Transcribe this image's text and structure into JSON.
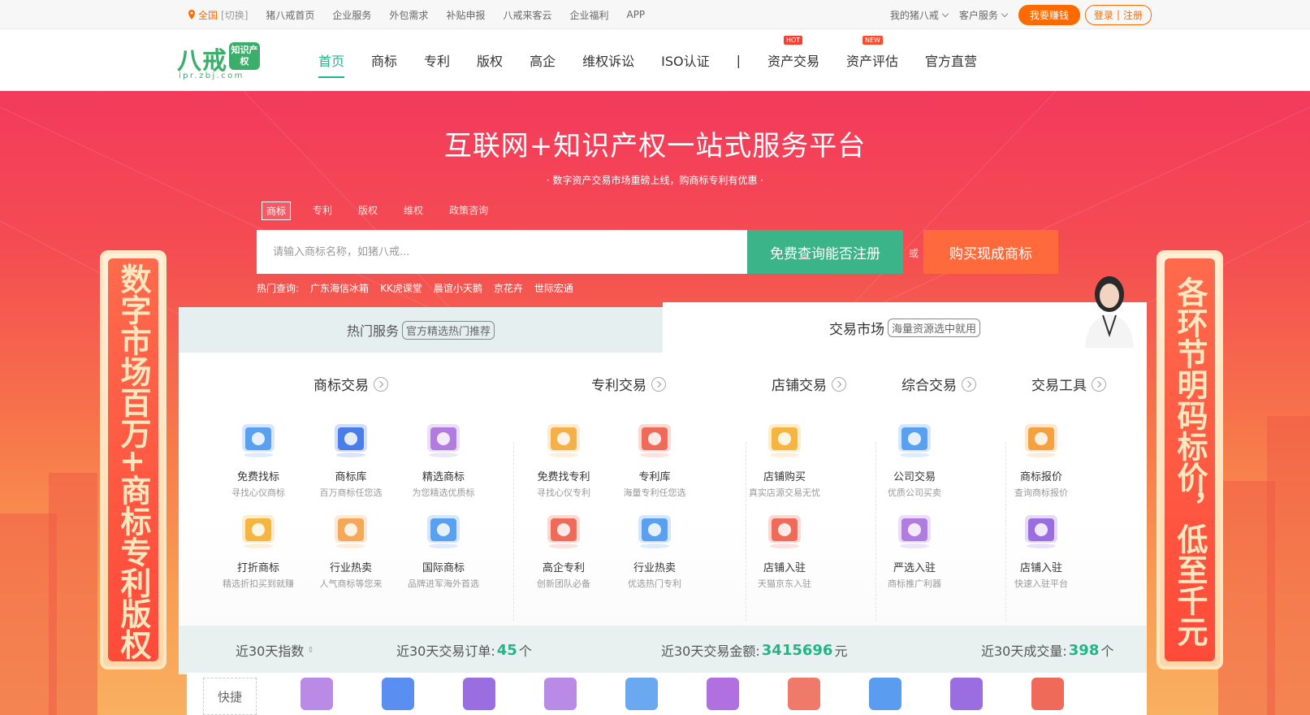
{
  "topbar": {
    "location_all": "全国",
    "location_switch": "[切换]",
    "links": [
      "猪八戒首页",
      "企业服务",
      "外包需求",
      "补贴申报",
      "八戒来客云",
      "企业福利",
      "APP"
    ],
    "my_zbj": "我的猪八戒",
    "customer_service": "客户服务",
    "earn_button": "我要赚钱",
    "login": "登录",
    "register": "注册"
  },
  "logo": {
    "mark": "八戒",
    "badge": "知识产权",
    "url": "ipr.zbj.com"
  },
  "nav": {
    "items": [
      "首页",
      "商标",
      "专利",
      "版权",
      "高企",
      "维权诉讼",
      "ISO认证",
      "|",
      "资产交易",
      "资产评估",
      "官方直营"
    ],
    "hot_tag": "HOT",
    "new_tag": "NEW"
  },
  "banner": {
    "headline": "互联网+知识产权一站式服务平台",
    "subline": "· 数字资产交易市场重磅上线，购商标专利有优惠 ·",
    "left_vertical": "数字市场百万+商标专利版权",
    "right_vertical": "各环节明码标价，低至千元起"
  },
  "search": {
    "tabs": [
      "商标",
      "专利",
      "版权",
      "维权",
      "政策咨询"
    ],
    "placeholder": "请输入商标名称，如猪八戒...",
    "query_button": "免费查询能否注册",
    "or": "或",
    "buy_button": "购买现成商标",
    "hot_label": "热门查询:",
    "hot_items": [
      "广东海信冰箱",
      "KK虎课堂",
      "晨谊小天鹅",
      "京花卉",
      "世际宏通"
    ]
  },
  "panel": {
    "tab1": "热门服务",
    "tab1_pill": "官方精选热门推荐",
    "tab2": "交易市场",
    "tab2_pill": "海量资源选中就用",
    "categories": [
      {
        "title": "商标交易"
      },
      {
        "title": "专利交易"
      },
      {
        "title": "店铺交易"
      },
      {
        "title": "综合交易"
      },
      {
        "title": "交易工具"
      }
    ],
    "items": [
      {
        "t": "免费找标",
        "s": "寻找心仪商标",
        "color": "#5aa0f0"
      },
      {
        "t": "商标库",
        "s": "百万商标任您选",
        "color": "#4a7de8"
      },
      {
        "t": "精选商标",
        "s": "为您精选优质标",
        "color": "#b07ce0"
      },
      {
        "t": "打折商标",
        "s": "精选折扣买到就赚",
        "color": "#f4b640"
      },
      {
        "t": "行业热卖",
        "s": "人气商标等您来",
        "color": "#f5a85a"
      },
      {
        "t": "国际商标",
        "s": "品牌进军海外首选",
        "color": "#5aa0f0"
      },
      {
        "t": "免费找专利",
        "s": "寻找心仪专利",
        "color": "#f6b04a"
      },
      {
        "t": "专利库",
        "s": "海量专利任您选",
        "color": "#f06a5a"
      },
      {
        "t": "高企专利",
        "s": "创新团队必备",
        "color": "#f06a5a"
      },
      {
        "t": "行业热卖",
        "s": "优选热门专利",
        "color": "#5aa0f0"
      },
      {
        "t": "店铺购买",
        "s": "真实店源交易无忧",
        "color": "#f4b640"
      },
      {
        "t": "店铺入驻",
        "s": "天猫京东入驻",
        "color": "#f06a5a"
      },
      {
        "t": "公司交易",
        "s": "优质公司买卖",
        "color": "#5aa0f0"
      },
      {
        "t": "严选入驻",
        "s": "商标推广利器",
        "color": "#b07ce0"
      },
      {
        "t": "商标报价",
        "s": "查询商标报价",
        "color": "#f6a040"
      },
      {
        "t": "店铺入驻",
        "s": "快速入驻平台",
        "color": "#9a6ee0"
      }
    ]
  },
  "stats": {
    "index_label": "近30天指数",
    "orders_label": "近30天交易订单:",
    "orders_value": "45",
    "orders_unit": "个",
    "amount_label": "近30天交易金额:",
    "amount_value": "3415696",
    "amount_unit": "元",
    "volume_label": "近30天成交量:",
    "volume_value": "398",
    "volume_unit": "个"
  },
  "quick": {
    "label": "快捷"
  }
}
